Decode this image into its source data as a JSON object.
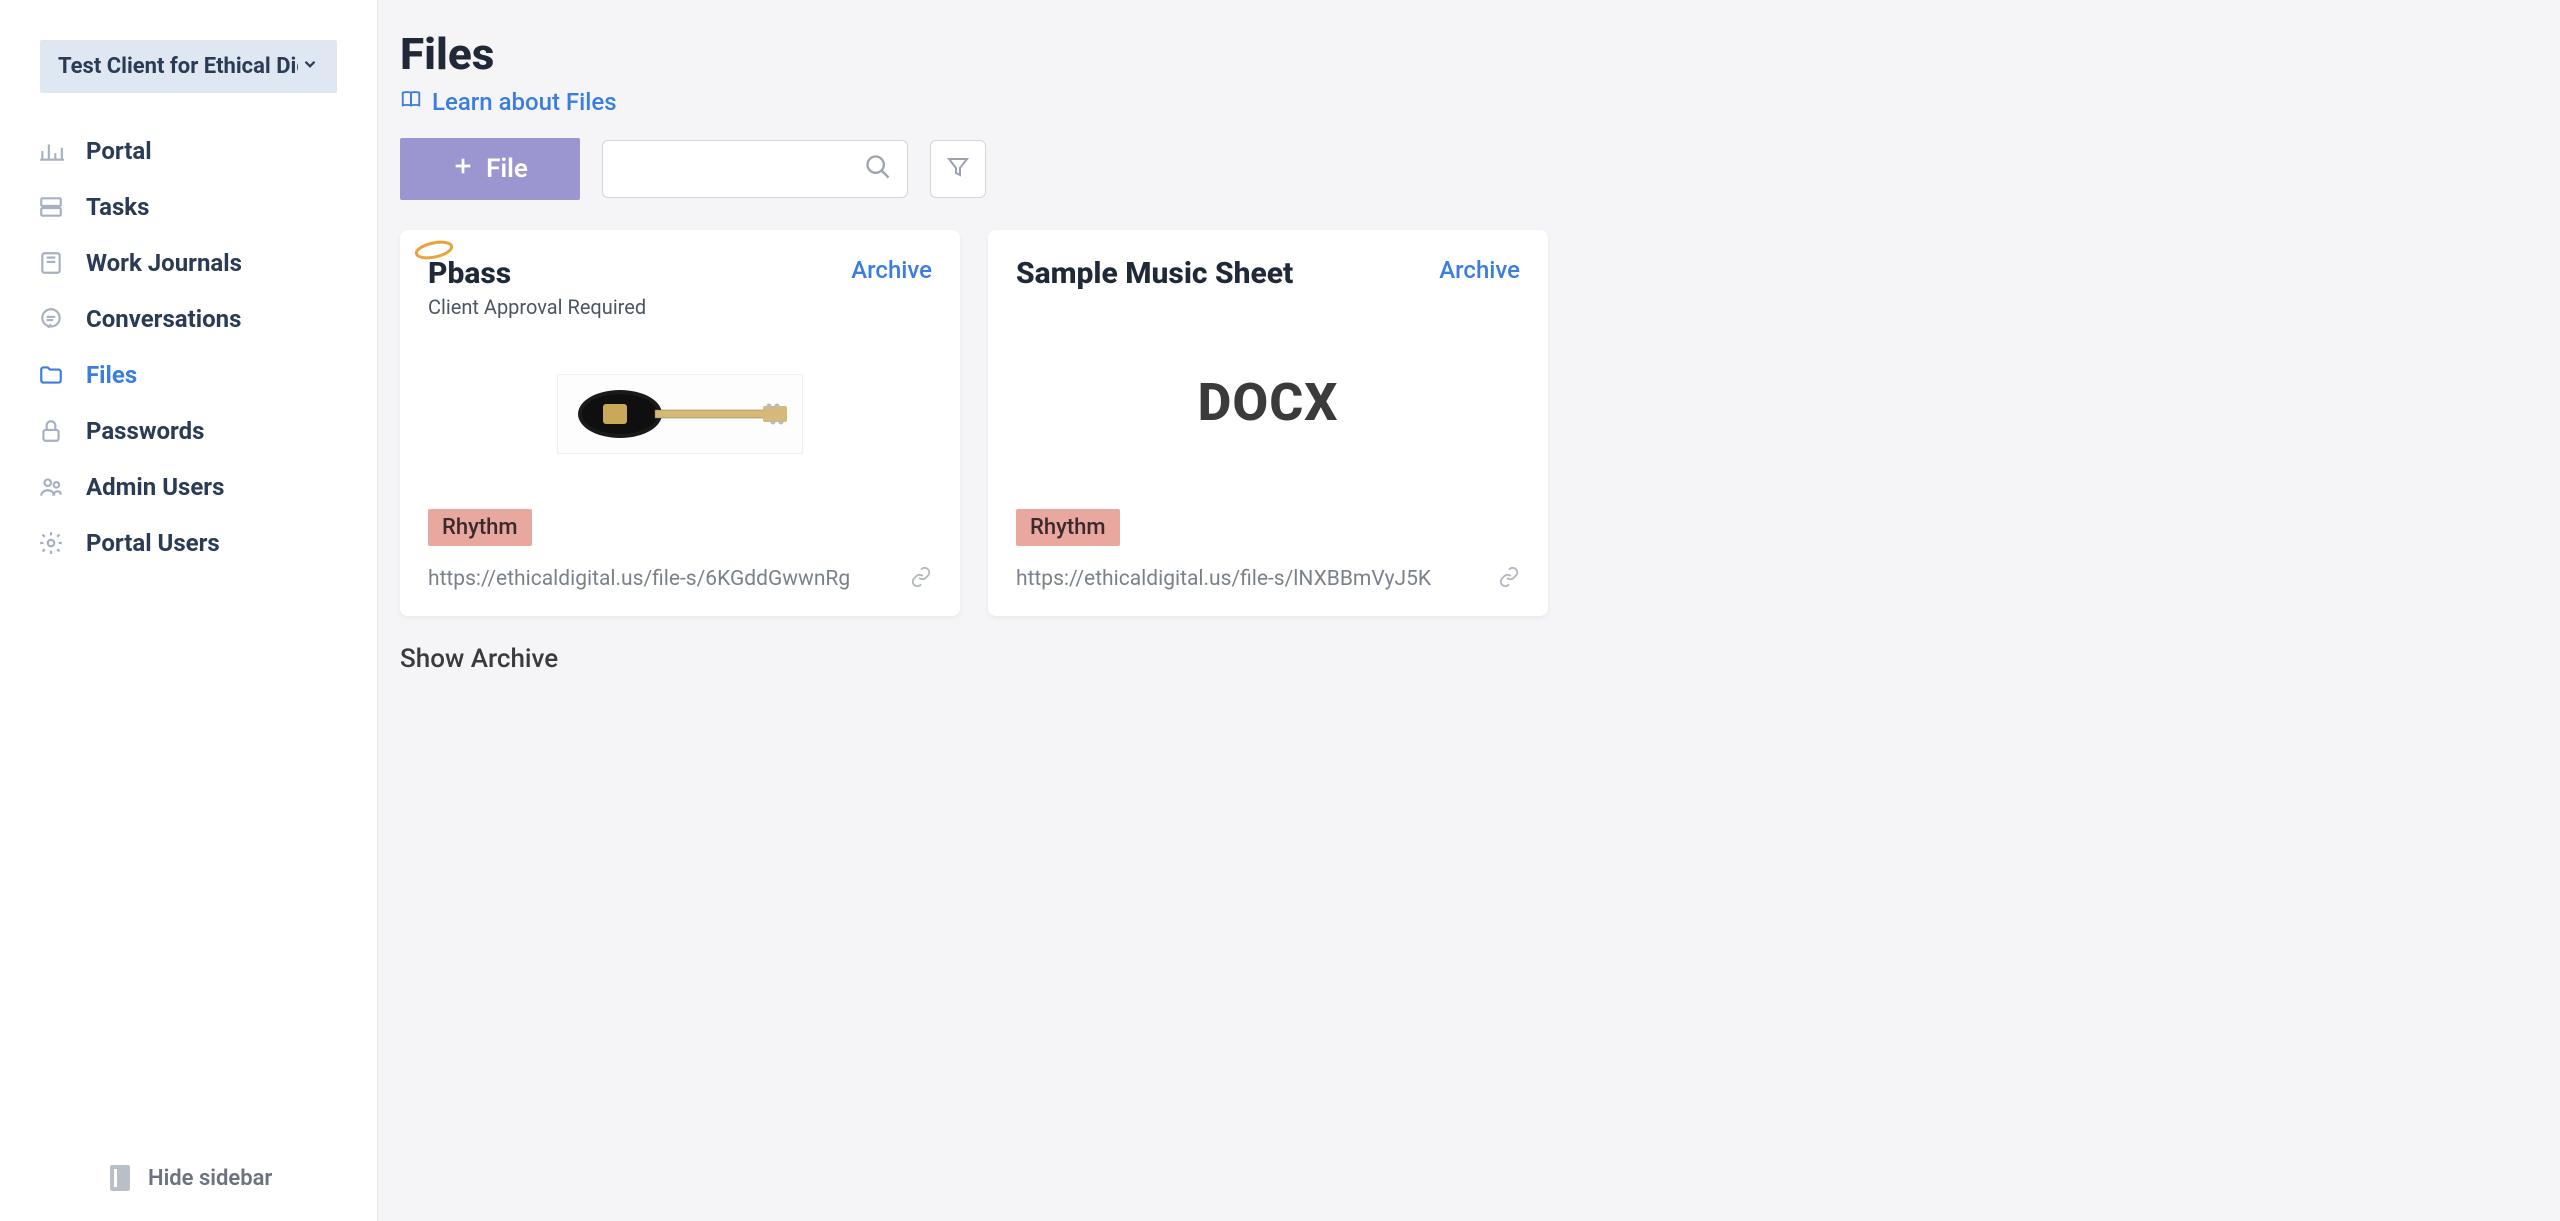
{
  "client_selector": {
    "label": "Test Client for Ethical Digit"
  },
  "sidebar": {
    "items": [
      {
        "label": "Portal"
      },
      {
        "label": "Tasks"
      },
      {
        "label": "Work Journals"
      },
      {
        "label": "Conversations"
      },
      {
        "label": "Files"
      },
      {
        "label": "Passwords"
      },
      {
        "label": "Admin Users"
      },
      {
        "label": "Portal Users"
      }
    ],
    "hide_label": "Hide sidebar"
  },
  "page": {
    "title": "Files",
    "learn_link": "Learn about Files",
    "add_button": "File",
    "show_archive": "Show Archive",
    "search_placeholder": ""
  },
  "cards": [
    {
      "title": "Pbass",
      "archive_label": "Archive",
      "subtitle": "Client Approval Required",
      "tag": "Rhythm",
      "url": "https://ethicaldigital.us/file-s/6KGddGwwnRg",
      "preview_type": "image"
    },
    {
      "title": "Sample Music Sheet",
      "archive_label": "Archive",
      "subtitle": "",
      "tag": "Rhythm",
      "url": "https://ethicaldigital.us/file-s/lNXBBmVyJ5K",
      "preview_type": "docx",
      "preview_label": "DOCX"
    }
  ]
}
